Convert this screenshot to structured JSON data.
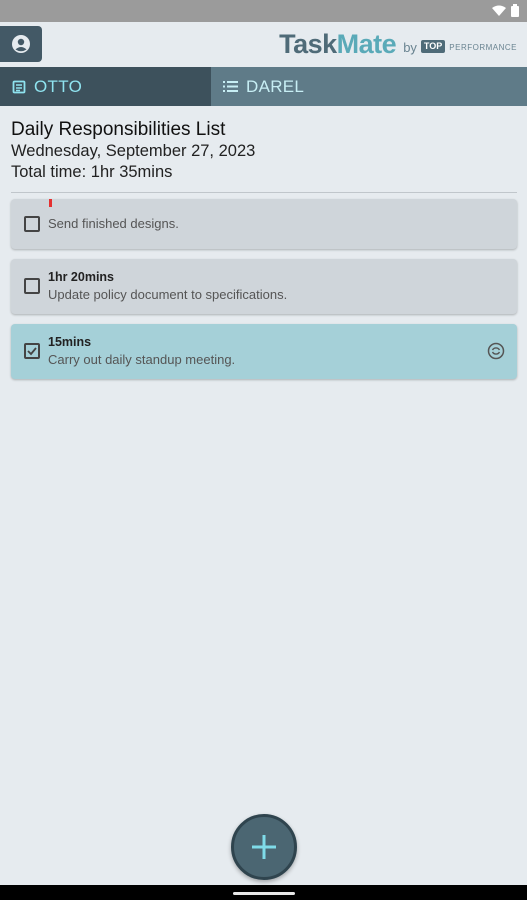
{
  "app": {
    "logo_task": "Task",
    "logo_mate": "Mate",
    "logo_by": "by",
    "logo_top": "TOP",
    "logo_performance": "PERFORMANCE"
  },
  "tabs": [
    {
      "label": "OTTO",
      "icon": "note-icon",
      "selected": true
    },
    {
      "label": "DAREL",
      "icon": "list-icon",
      "selected": false
    }
  ],
  "header": {
    "title": "Daily Responsibilities List",
    "date": "Wednesday, September 27, 2023",
    "total": "Total time: 1hr 35mins"
  },
  "tasks": [
    {
      "time": "",
      "description": "Send finished designs.",
      "checked": false
    },
    {
      "time": "1hr 20mins",
      "description": "Update policy document to specifications.",
      "checked": false
    },
    {
      "time": "15mins",
      "description": "Carry out daily standup meeting.",
      "checked": true
    }
  ],
  "colors": {
    "background": "#e6ebef",
    "tab_selected": "#3d515c",
    "tab_unselected": "#5f7b88",
    "accent": "#8fe3ef",
    "task_card": "#cfd5da",
    "task_done": "#a5d0d8",
    "fab": "#4b6672"
  }
}
